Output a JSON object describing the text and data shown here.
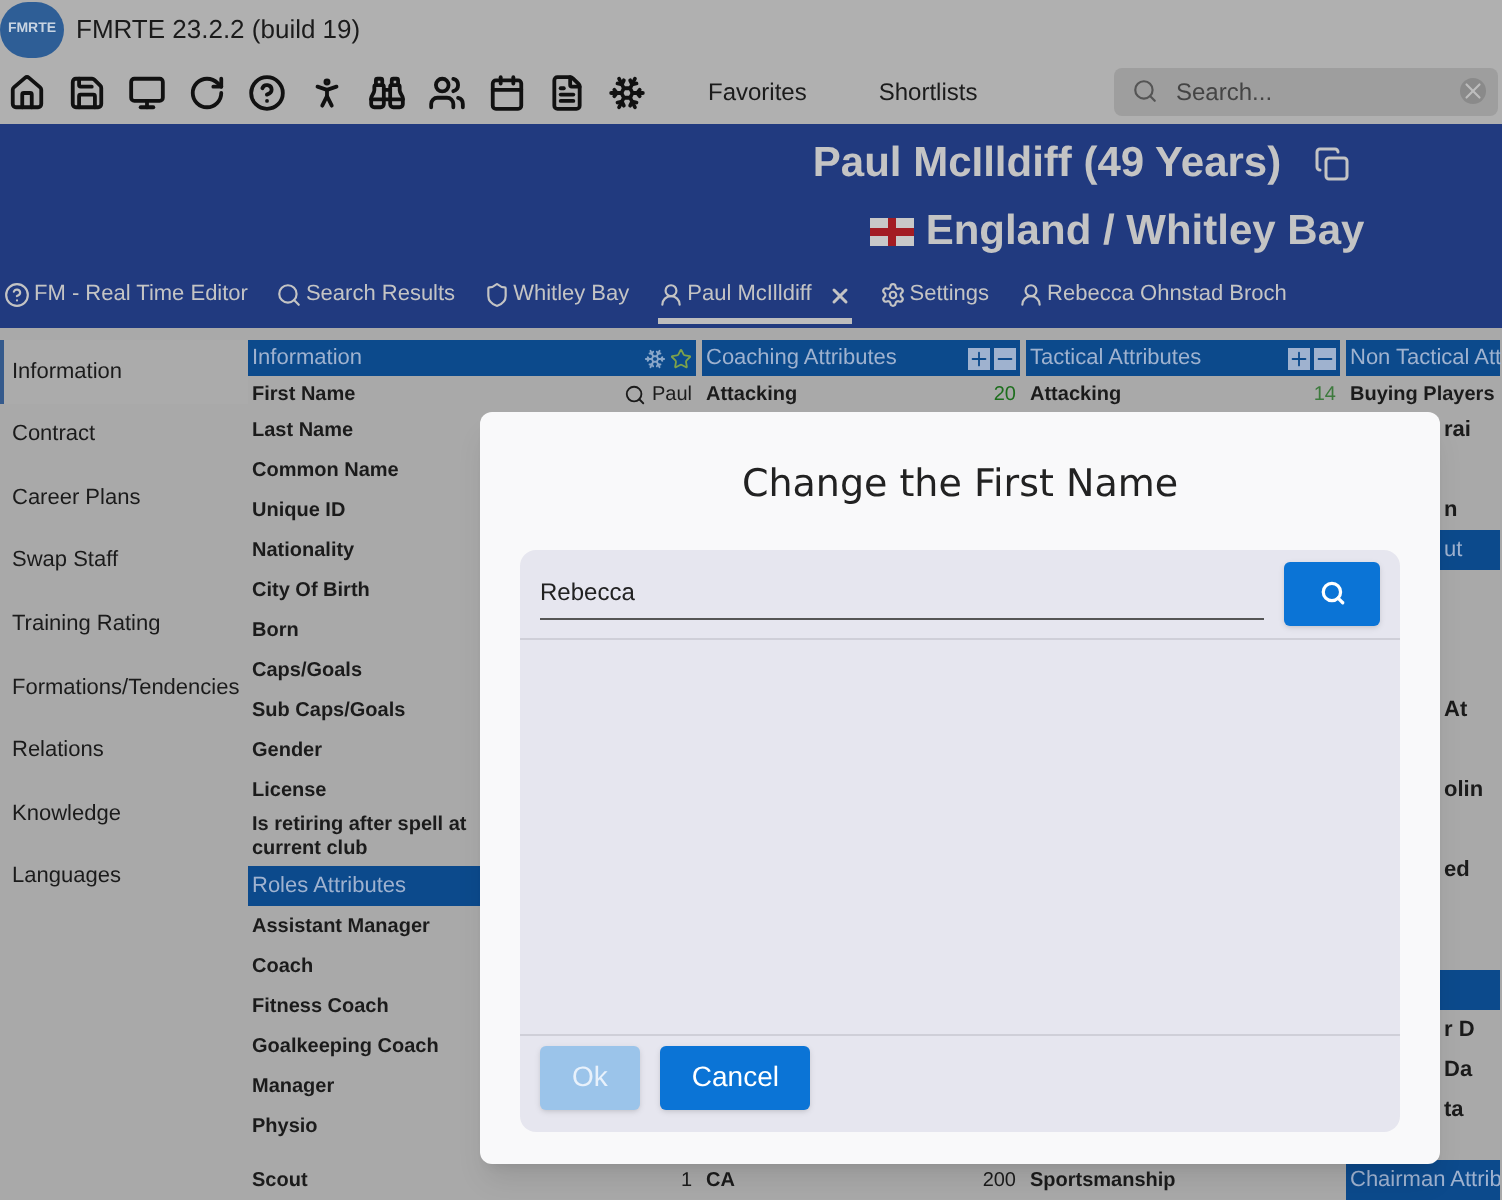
{
  "window": {
    "logo_text": "FMRTE",
    "title": "FMRTE 23.2.2 (build 19)"
  },
  "toolbar": {
    "menus": [
      "Favorites",
      "Shortlists"
    ],
    "search": {
      "placeholder": "Search..."
    }
  },
  "header": {
    "title": "Paul McIlldiff (49 Years)",
    "subtitle": "England / Whitley Bay"
  },
  "tabs": [
    {
      "label": "FM - Real Time Editor",
      "kind": "help",
      "selected": false,
      "closable": false
    },
    {
      "label": "Search Results",
      "kind": "search",
      "selected": false,
      "closable": false
    },
    {
      "label": "Whitley Bay",
      "kind": "club",
      "selected": false,
      "closable": false
    },
    {
      "label": "Paul McIlldiff",
      "kind": "person",
      "selected": true,
      "closable": true
    },
    {
      "label": "Settings",
      "kind": "settings",
      "selected": false,
      "closable": false
    },
    {
      "label": "Rebecca Ohnstad Broch",
      "kind": "person",
      "selected": false,
      "closable": false
    }
  ],
  "sidebar": {
    "items": [
      {
        "label": "Information",
        "selected": true
      },
      {
        "label": "Contract",
        "selected": false
      },
      {
        "label": "Career Plans",
        "selected": false
      },
      {
        "label": "Swap Staff",
        "selected": false
      },
      {
        "label": "Training Rating",
        "selected": false
      },
      {
        "label": "Formations/Tendencies",
        "selected": false
      },
      {
        "label": "Relations",
        "selected": false
      },
      {
        "label": "Knowledge",
        "selected": false
      },
      {
        "label": "Languages",
        "selected": false
      }
    ]
  },
  "columns": [
    {
      "title": "Information",
      "kind": "favorite",
      "rows": [
        {
          "kind": "row",
          "label": "First Name",
          "value": "Paul",
          "searchable": true
        },
        {
          "kind": "row",
          "label": "Last Name"
        },
        {
          "kind": "row",
          "label": "Common Name"
        },
        {
          "kind": "row",
          "label": "Unique ID"
        },
        {
          "kind": "row",
          "label": "Nationality"
        },
        {
          "kind": "row",
          "label": "City Of Birth"
        },
        {
          "kind": "row",
          "label": "Born"
        },
        {
          "kind": "row",
          "label": "Caps/Goals"
        },
        {
          "kind": "row",
          "label": "Sub Caps/Goals"
        },
        {
          "kind": "row",
          "label": "Gender"
        },
        {
          "kind": "row",
          "label": "License"
        },
        {
          "kind": "tall",
          "label": "Is retiring after spell at current club"
        },
        {
          "kind": "header",
          "label": "Roles Attributes"
        },
        {
          "kind": "row",
          "label": "Assistant Manager"
        },
        {
          "kind": "row",
          "label": "Coach"
        },
        {
          "kind": "row",
          "label": "Fitness Coach"
        },
        {
          "kind": "row",
          "label": "Goalkeeping Coach"
        },
        {
          "kind": "row",
          "label": "Manager"
        },
        {
          "kind": "row",
          "label": "Physio"
        },
        {
          "kind": "row",
          "label": "Scout",
          "value": "1"
        }
      ]
    },
    {
      "title": "Coaching Attributes",
      "kind": "expand",
      "rows": [
        {
          "kind": "row",
          "label": "Attacking",
          "value": "20",
          "color": "#1d6e1d"
        },
        {
          "kind": "hidden"
        },
        {
          "kind": "hidden"
        },
        {
          "kind": "hidden"
        },
        {
          "kind": "hidden"
        },
        {
          "kind": "hidden"
        },
        {
          "kind": "hidden"
        },
        {
          "kind": "hidden"
        },
        {
          "kind": "hidden"
        },
        {
          "kind": "hidden"
        },
        {
          "kind": "hidden"
        },
        {
          "kind": "hidden"
        },
        {
          "kind": "hidden"
        },
        {
          "kind": "hidden"
        },
        {
          "kind": "hidden"
        },
        {
          "kind": "hidden"
        },
        {
          "kind": "hidden"
        },
        {
          "kind": "hidden"
        },
        {
          "kind": "row",
          "label": "CA",
          "value": "200"
        }
      ]
    },
    {
      "title": "Tactical Attributes",
      "kind": "expand",
      "rows": [
        {
          "kind": "row",
          "label": "Attacking",
          "value": "14",
          "color": "#3d7a3d"
        },
        {
          "kind": "hidden"
        },
        {
          "kind": "hidden"
        },
        {
          "kind": "hidden"
        },
        {
          "kind": "hidden"
        },
        {
          "kind": "hidden"
        },
        {
          "kind": "hidden"
        },
        {
          "kind": "hidden"
        },
        {
          "kind": "hidden"
        },
        {
          "kind": "hidden"
        },
        {
          "kind": "hidden"
        },
        {
          "kind": "hidden"
        },
        {
          "kind": "hidden"
        },
        {
          "kind": "hidden"
        },
        {
          "kind": "hidden"
        },
        {
          "kind": "hidden"
        },
        {
          "kind": "hidden"
        },
        {
          "kind": "hidden"
        },
        {
          "kind": "hidden"
        },
        {
          "kind": "row",
          "label": "Sportsmanship"
        }
      ]
    },
    {
      "title": "Non Tactical Att",
      "kind": "plain",
      "rows": [
        {
          "kind": "row",
          "label": "Buying Players"
        },
        {
          "kind": "peek",
          "label": "rai"
        },
        {
          "kind": "hidden"
        },
        {
          "kind": "peek",
          "label": "n"
        },
        {
          "kind": "peekheader",
          "label": "ut"
        },
        {
          "kind": "hidden"
        },
        {
          "kind": "hidden"
        },
        {
          "kind": "hidden"
        },
        {
          "kind": "peek",
          "label": "At"
        },
        {
          "kind": "hidden"
        },
        {
          "kind": "peek",
          "label": "olin"
        },
        {
          "kind": "hidden"
        },
        {
          "kind": "peek",
          "label": "ed"
        },
        {
          "kind": "hidden"
        },
        {
          "kind": "hidden"
        },
        {
          "kind": "peekheader"
        },
        {
          "kind": "peek",
          "label": "r D"
        },
        {
          "kind": "peek",
          "label": "Da"
        },
        {
          "kind": "peek",
          "label": "ta"
        },
        {
          "kind": "header",
          "label": "Chairman Attrib"
        }
      ]
    }
  ],
  "dialog": {
    "title": "Change the First Name",
    "field": {
      "value": "Rebecca"
    },
    "buttons": [
      {
        "label": "Ok",
        "disabled": true
      },
      {
        "label": "Cancel",
        "disabled": false
      }
    ]
  }
}
